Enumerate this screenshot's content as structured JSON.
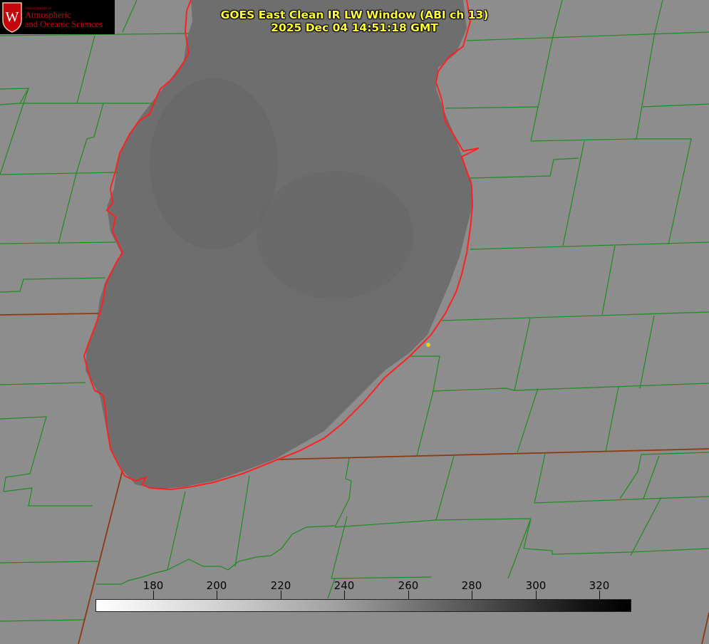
{
  "logo": {
    "small_text": "Department of",
    "line1": "Atmospheric",
    "line2": "and Oceanic Sciences",
    "crest_letter": "W",
    "color": "#c5050c"
  },
  "title": {
    "line1": "GOES East Clean IR LW Window (ABI ch 13)",
    "line2": "2025 Dec 04 14:51:18 GMT",
    "color": "#ffff33"
  },
  "colorbar": {
    "ticks": [
      "180",
      "200",
      "220",
      "240",
      "260",
      "280",
      "300",
      "320"
    ],
    "low_color": "#ffffff",
    "high_color": "#000000"
  },
  "map": {
    "county_line_color": "#1e8c1e",
    "state_line_color": "#8b3a0f",
    "coastline_color": "#ff2020",
    "marker_color": "#e6d21a",
    "lake_color": "#6e6e6e",
    "land_color": "#8d8d8d"
  }
}
